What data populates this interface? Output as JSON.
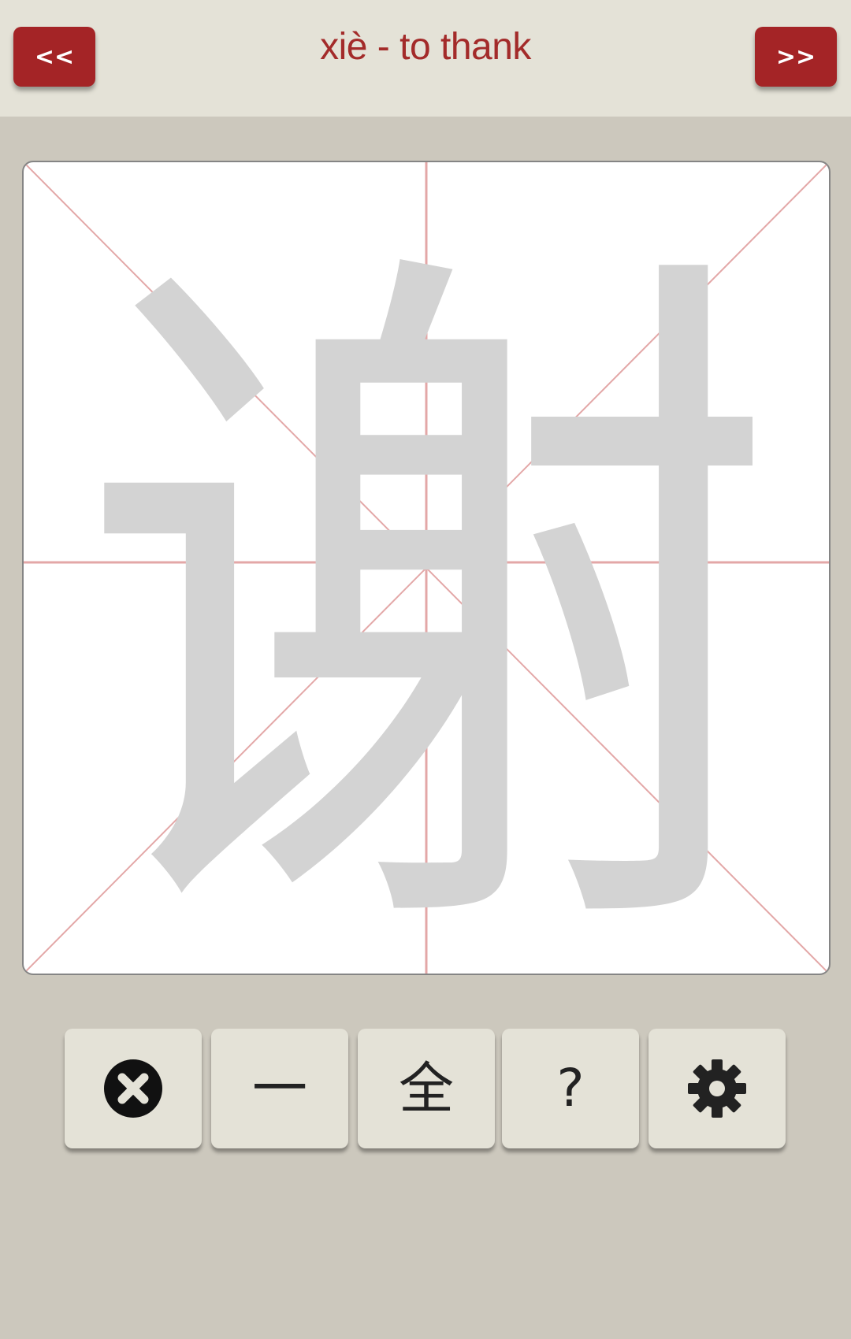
{
  "header": {
    "prev_label": "<<",
    "next_label": ">>",
    "title": "xiè - to thank"
  },
  "character": {
    "glyph": "谢",
    "stroke_color": "#d3d3d3",
    "guide_color": "#e3a7a7"
  },
  "toolbar": {
    "buttons": [
      {
        "name": "close",
        "icon": "close-circle-icon"
      },
      {
        "name": "stroke",
        "label": "一"
      },
      {
        "name": "full",
        "label": "全"
      },
      {
        "name": "help",
        "label": "?"
      },
      {
        "name": "settings",
        "icon": "gear-icon"
      }
    ]
  },
  "colors": {
    "background": "#ccc8bd",
    "header": "#e4e2d7",
    "accent": "#a42426",
    "title": "#a32b2a"
  }
}
